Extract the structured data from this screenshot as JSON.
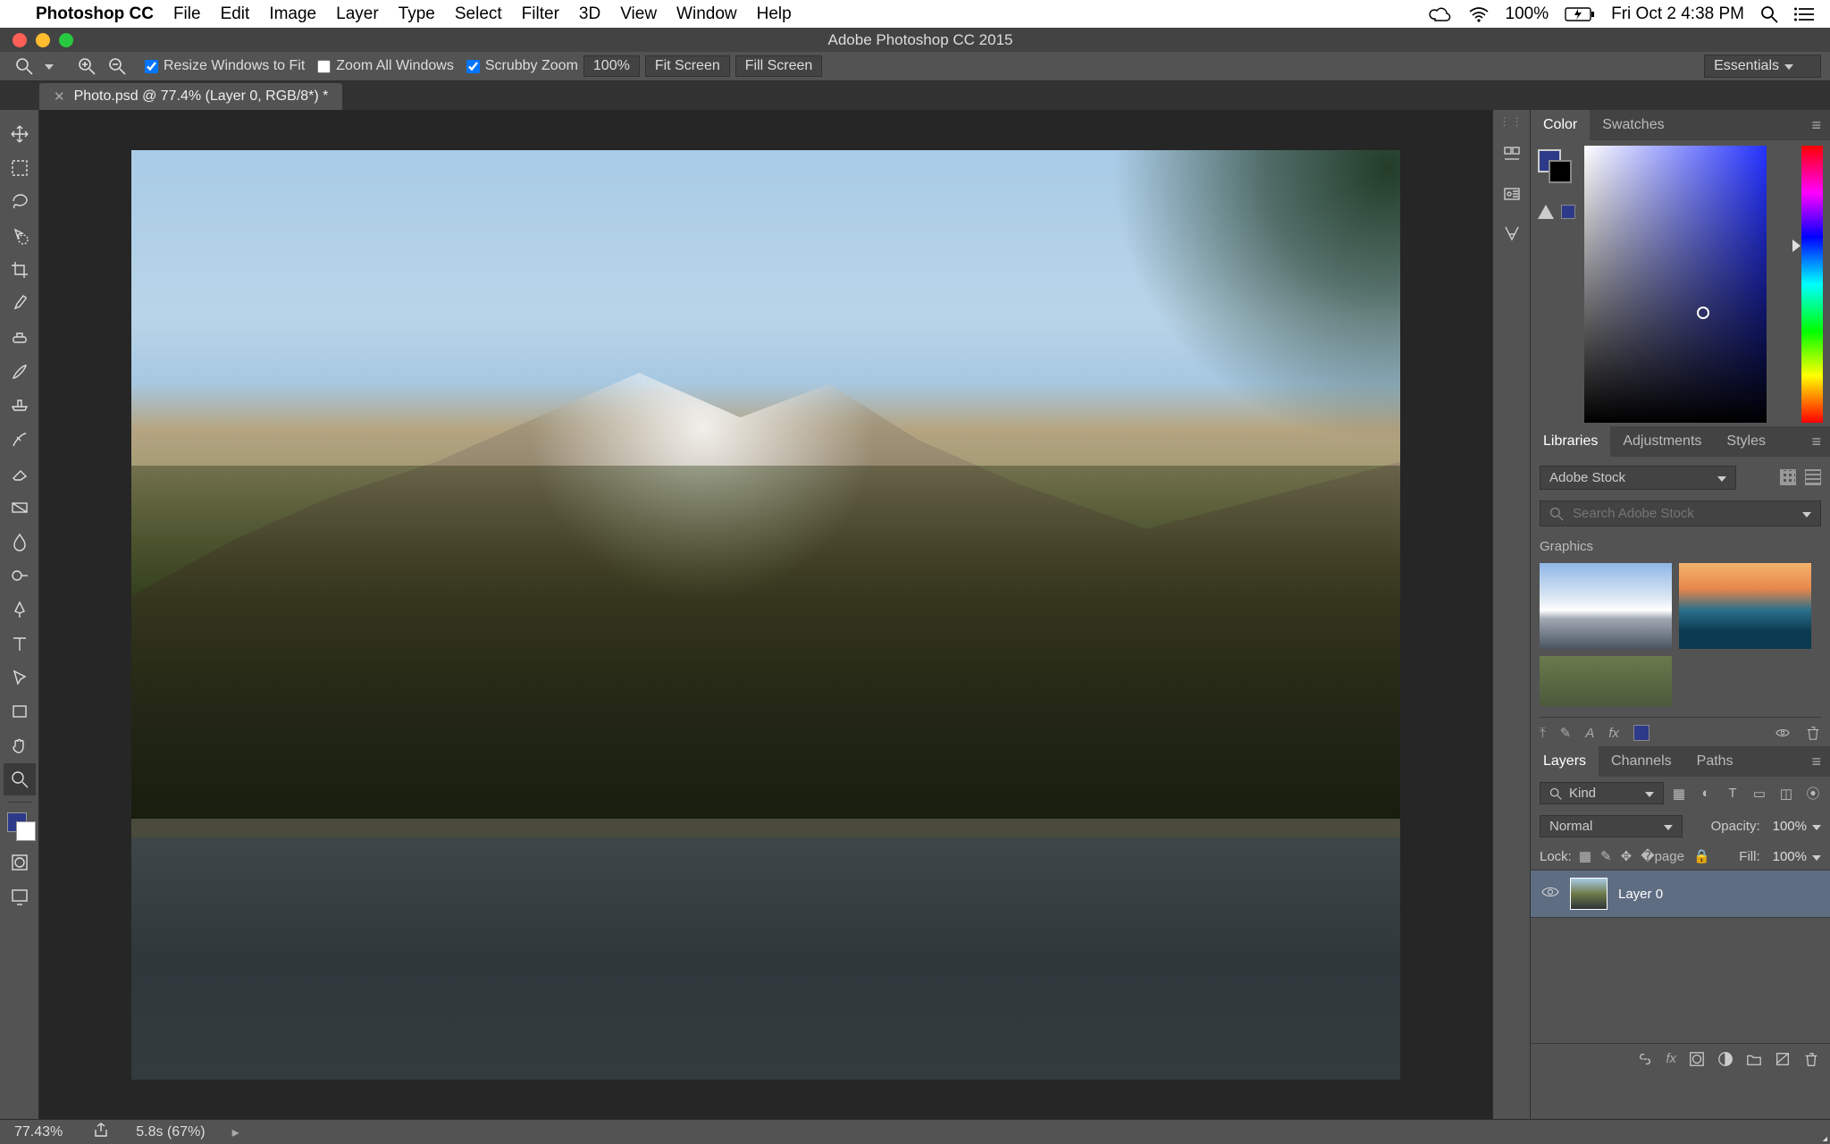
{
  "mac_menu": {
    "app_name": "Photoshop CC",
    "items": [
      "File",
      "Edit",
      "Image",
      "Layer",
      "Type",
      "Select",
      "Filter",
      "3D",
      "View",
      "Window",
      "Help"
    ],
    "battery_pct": "100%",
    "clock": "Fri Oct 2  4:38 PM"
  },
  "window": {
    "title": "Adobe Photoshop CC 2015"
  },
  "options_bar": {
    "resize_windows_label": "Resize Windows to Fit",
    "zoom_all_label": "Zoom All Windows",
    "scrubby_zoom_label": "Scrubby Zoom",
    "zoom_value": "100%",
    "fit_screen": "Fit Screen",
    "fill_screen": "Fill Screen",
    "workspace": "Essentials"
  },
  "document_tab": {
    "label": "Photo.psd @ 77.4% (Layer 0, RGB/8*) *"
  },
  "panels": {
    "color": {
      "tabs": [
        "Color",
        "Swatches"
      ],
      "active": "Color"
    },
    "libraries": {
      "tabs": [
        "Libraries",
        "Adjustments",
        "Styles"
      ],
      "active": "Libraries",
      "source": "Adobe Stock",
      "search_placeholder": "Search Adobe Stock",
      "section_title": "Graphics"
    },
    "layers": {
      "tabs": [
        "Layers",
        "Channels",
        "Paths"
      ],
      "active": "Layers",
      "kind_label": "Kind",
      "blend_mode": "Normal",
      "opacity_label": "Opacity:",
      "opacity_value": "100%",
      "lock_label": "Lock:",
      "fill_label": "Fill:",
      "fill_value": "100%",
      "items": [
        {
          "name": "Layer 0",
          "visible": true
        }
      ]
    }
  },
  "status_bar": {
    "zoom": "77.43%",
    "timing": "5.8s (67%)"
  },
  "colors": {
    "foreground": "#2d3a8a",
    "background": "#ffffff"
  }
}
